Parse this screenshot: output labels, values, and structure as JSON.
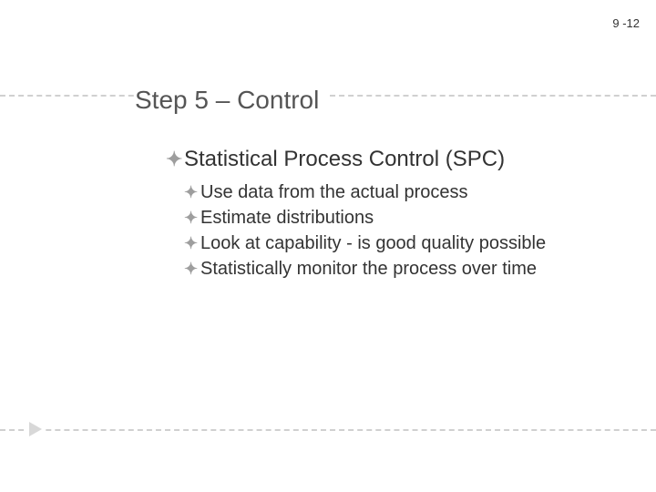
{
  "page_number": "9 -12",
  "title": "Step 5 – Control",
  "main_item": "Statistical Process Control (SPC)",
  "sub_items": [
    "Use data from the actual process",
    "Estimate distributions",
    "Look at capability - is good quality possible",
    "Statistically monitor the process over time"
  ]
}
